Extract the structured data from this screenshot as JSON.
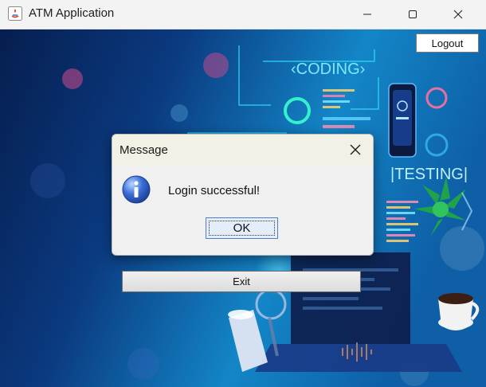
{
  "window": {
    "title": "ATM Application",
    "icon": "java-icon",
    "controls": [
      "minimize-icon",
      "maximize-icon",
      "close-icon"
    ]
  },
  "main": {
    "logout_label": "Logout",
    "exit_label": "Exit",
    "background": {
      "coding_text": "‹CODING›",
      "testing_text": "|TESTING|"
    }
  },
  "dialog": {
    "title": "Message",
    "message": "Login successful!",
    "ok_label": "OK",
    "icon": "information-icon"
  },
  "colors": {
    "accent": "#4b7fcf",
    "background_dark": "#0a2a66",
    "background_cyan": "#1fb8e6"
  }
}
